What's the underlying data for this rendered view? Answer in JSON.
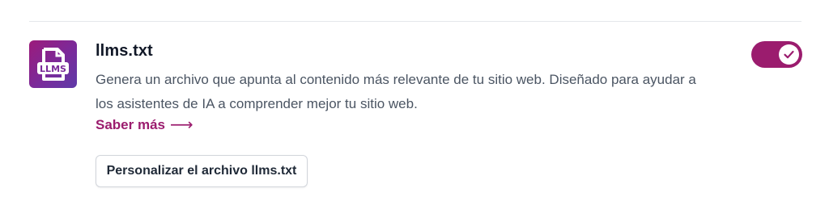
{
  "feature": {
    "icon": "llms-file-icon",
    "icon_text": "LLMS",
    "title": "llms.txt",
    "description": "Genera un archivo que apunta al contenido más relevante de tu sitio web. Diseñado para ayudar a los asistentes de IA a comprender mejor tu sitio web.",
    "learn_more_label": "Saber más",
    "learn_more_icon": "arrow-right-icon",
    "customize_button_label": "Personalizar el archivo llms.txt",
    "enabled": true
  },
  "colors": {
    "accent": "#9b1c6e",
    "icon_gradient_start": "#9c1b7b",
    "icon_gradient_end": "#5f3aa8"
  }
}
